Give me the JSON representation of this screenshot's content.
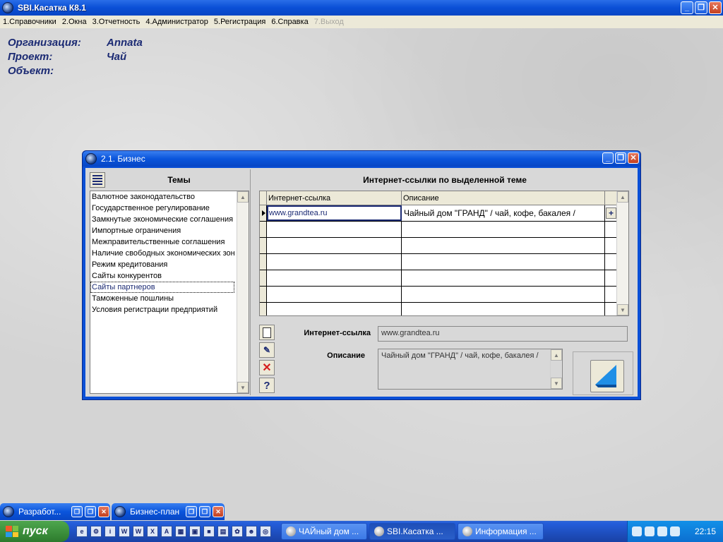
{
  "app": {
    "title": "SBI.Касатка К8.1",
    "controls": {
      "minimize": "_",
      "maximize": "❐",
      "close": "✕"
    }
  },
  "menu": [
    "1.Справочники",
    "2.Окна",
    "3.Отчетность",
    "4.Администратор",
    "5.Регистрация",
    "6.Справка",
    "7.Выход"
  ],
  "info": {
    "org_label": "Организация:",
    "org_value": "Annata",
    "project_label": "Проект:",
    "project_value": "Чай",
    "object_label": "Объект:",
    "object_value": ""
  },
  "window": {
    "title": "2.1. Бизнес",
    "topics_heading": "Темы",
    "topics": [
      "Валютное законодательство",
      "Государственное регулирование",
      "Замкнутые экономические соглашения",
      "Импортные ограничения",
      "Межправительственные соглашения",
      "Наличие свободных экономических зон",
      "Режим кредитования",
      "Сайты конкурентов",
      "Сайты партнеров",
      "Таможенные пошлины",
      "Условия регистрации предприятий"
    ],
    "selected_topic": "Сайты партнеров",
    "grid_heading": "Интернет-ссылки по выделенной теме",
    "grid_columns": [
      "Интернет-ссылка",
      "Описание"
    ],
    "grid_rows": [
      {
        "url": "www.grandtea.ru",
        "desc": "Чайный дом \"ГРАНД\" / чай, кофе, бакалея /"
      }
    ],
    "plus": "+",
    "field_url_label": "Интернет-ссылка",
    "field_url_value": "www.grandtea.ru",
    "field_desc_label": "Описание",
    "field_desc_value": "Чайный дом \"ГРАНД\" / чай, кофе, бакалея /",
    "tool_icons": [
      "new-document-icon",
      "edit-icon",
      "delete-icon",
      "help-icon"
    ]
  },
  "minimized": [
    {
      "title": "Разработ..."
    },
    {
      "title": "Бизнес-план"
    }
  ],
  "taskbar": {
    "start": "пуск",
    "quick_icons": [
      "e",
      "⚙",
      "i",
      "W",
      "W",
      "X",
      "A",
      "▦",
      "▣",
      "■",
      "▤",
      "✿",
      "☻",
      "◎"
    ],
    "tasks": [
      {
        "title": "ЧАЙный дом ...",
        "active": false
      },
      {
        "title": "SBI.Касатка ...",
        "active": true
      },
      {
        "title": "Информация ...",
        "active": false
      }
    ],
    "clock": "22:15"
  },
  "colors": {
    "accent": "#0a4fd6",
    "info_text": "#1b2a73",
    "start_green": "#3a8d3a"
  }
}
